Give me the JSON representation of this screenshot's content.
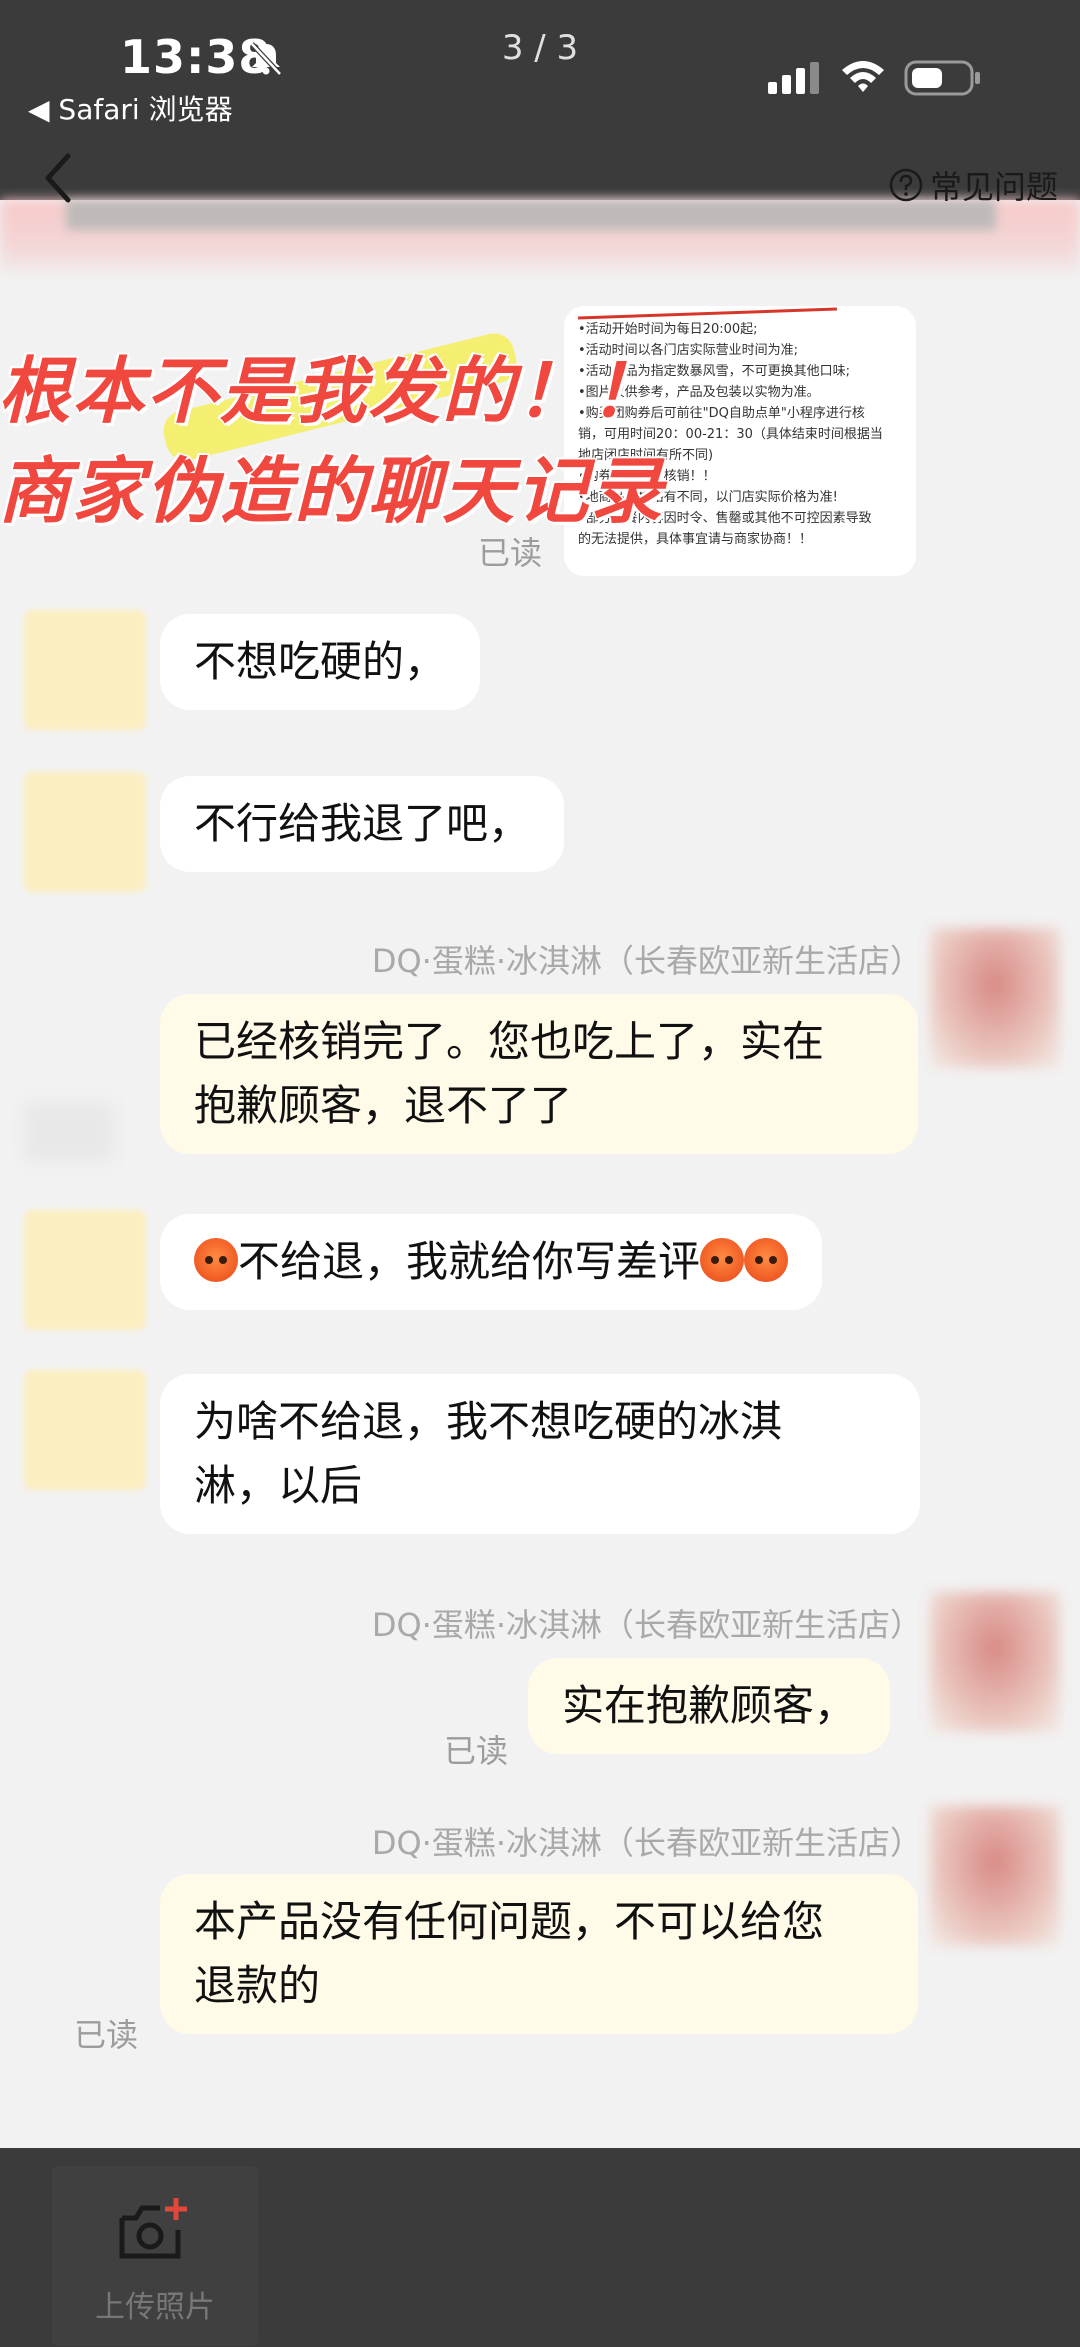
{
  "status_bar": {
    "time": "13:38",
    "back_app": "◀ Safari 浏览器",
    "page_counter": "3 / 3"
  },
  "header": {
    "faq_label": "常见问题"
  },
  "overlay": {
    "line1": "根本不是我发的！！",
    "line2": "商家伪造的聊天记录"
  },
  "image_message": {
    "rules": [
      "•活动开始时间为每日20:00起;",
      "•活动时间以各门店实际营业时间为准;",
      "•活动产品为指定数暴风雪，不可更换其他口味;",
      "•图片仅供参考，产品及包装以实物为准。",
      "•购买团购券后可前往\"DQ自助点单\"小程序进行核",
      "销，可用时间20：00-21：30（具体结束时间根据当",
      "地店闭店时间有所不同)",
      "•购券支持到店核销！！",
      "•地商品价格略有不同，以门店实际价格为准!",
      "•部分套餐内容因时令、售罄或其他不可控因素导致",
      "的无法提供，具体事宜请与商家协商！！"
    ],
    "read": "已读"
  },
  "messages": [
    {
      "sender": "",
      "text": "不想吃硬的，"
    },
    {
      "sender": "",
      "text": "不行给我退了吧，"
    },
    {
      "sender": "DQ·蛋糕·冰淇淋（长春欧亚新生活店）",
      "line1": "已经核销完了。您也吃上了，实在",
      "line2": "抱歉顾客，退不了了"
    },
    {
      "sender": "",
      "text": "不给退，我就给你写差评"
    },
    {
      "sender": "",
      "line1": "为啥不给退，我不想吃硬的冰淇",
      "line2": "淋，以后"
    },
    {
      "sender": "DQ·蛋糕·冰淇淋（长春欧亚新生活店）",
      "text": "实在抱歉顾客，",
      "read": "已读"
    },
    {
      "sender": "DQ·蛋糕·冰淇淋（长春欧亚新生活店）",
      "line1": "本产品没有任何问题，不可以给您",
      "line2": "退款的",
      "read": "已读"
    }
  ],
  "bottom_bar": {
    "upload_label": "上传照片"
  },
  "colors": {
    "bar_bg": "#3b3b3b",
    "merchant_bubble": "#fffbe8",
    "user_bubble": "#ffffff",
    "overlay_red": "#f0473e"
  }
}
